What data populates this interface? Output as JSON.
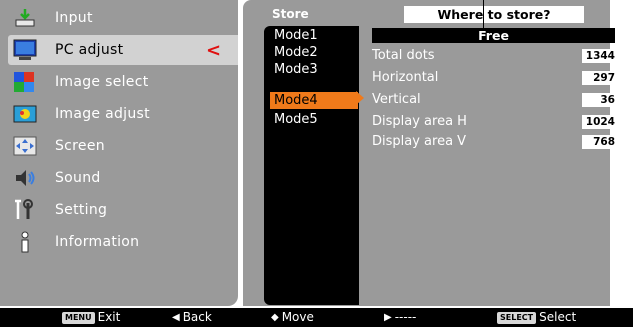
{
  "menu": {
    "items": [
      {
        "label": "Input",
        "icon": "input-icon"
      },
      {
        "label": "PC adjust",
        "icon": "pc-adjust-icon",
        "active": true
      },
      {
        "label": "Image select",
        "icon": "image-select-icon"
      },
      {
        "label": "Image adjust",
        "icon": "image-adjust-icon"
      },
      {
        "label": "Screen",
        "icon": "screen-icon"
      },
      {
        "label": "Sound",
        "icon": "sound-icon"
      },
      {
        "label": "Setting",
        "icon": "setting-icon"
      },
      {
        "label": "Information",
        "icon": "information-icon"
      }
    ],
    "active_indicator": "<"
  },
  "store": {
    "label": "Store",
    "modes": [
      "Mode1",
      "Mode2",
      "Mode3",
      "Mode4",
      "Mode5"
    ],
    "selected_mode": "Mode4"
  },
  "prompt": {
    "where_text": "Where to store?",
    "status": "Free"
  },
  "info": [
    {
      "label": "Total dots",
      "value": "1344"
    },
    {
      "label": "Horizontal",
      "value": "297"
    },
    {
      "label": "Vertical",
      "value": "36"
    },
    {
      "label": "Display area H",
      "value": "1024"
    },
    {
      "label": "Display area V",
      "value": "768"
    }
  ],
  "bottom_bar": {
    "exit": {
      "key": "MENU",
      "label": "Exit"
    },
    "back": {
      "glyph": "◀",
      "label": "Back"
    },
    "move": {
      "glyph": "◆",
      "label": "Move"
    },
    "next": {
      "glyph": "▶",
      "label": "-----"
    },
    "select": {
      "key": "SELECT",
      "label": "Select"
    }
  },
  "colors": {
    "panel_bg": "#9a9a9a",
    "highlight": "#f07a1a",
    "active_arrow": "#e01010",
    "bar_bg": "#000000"
  }
}
